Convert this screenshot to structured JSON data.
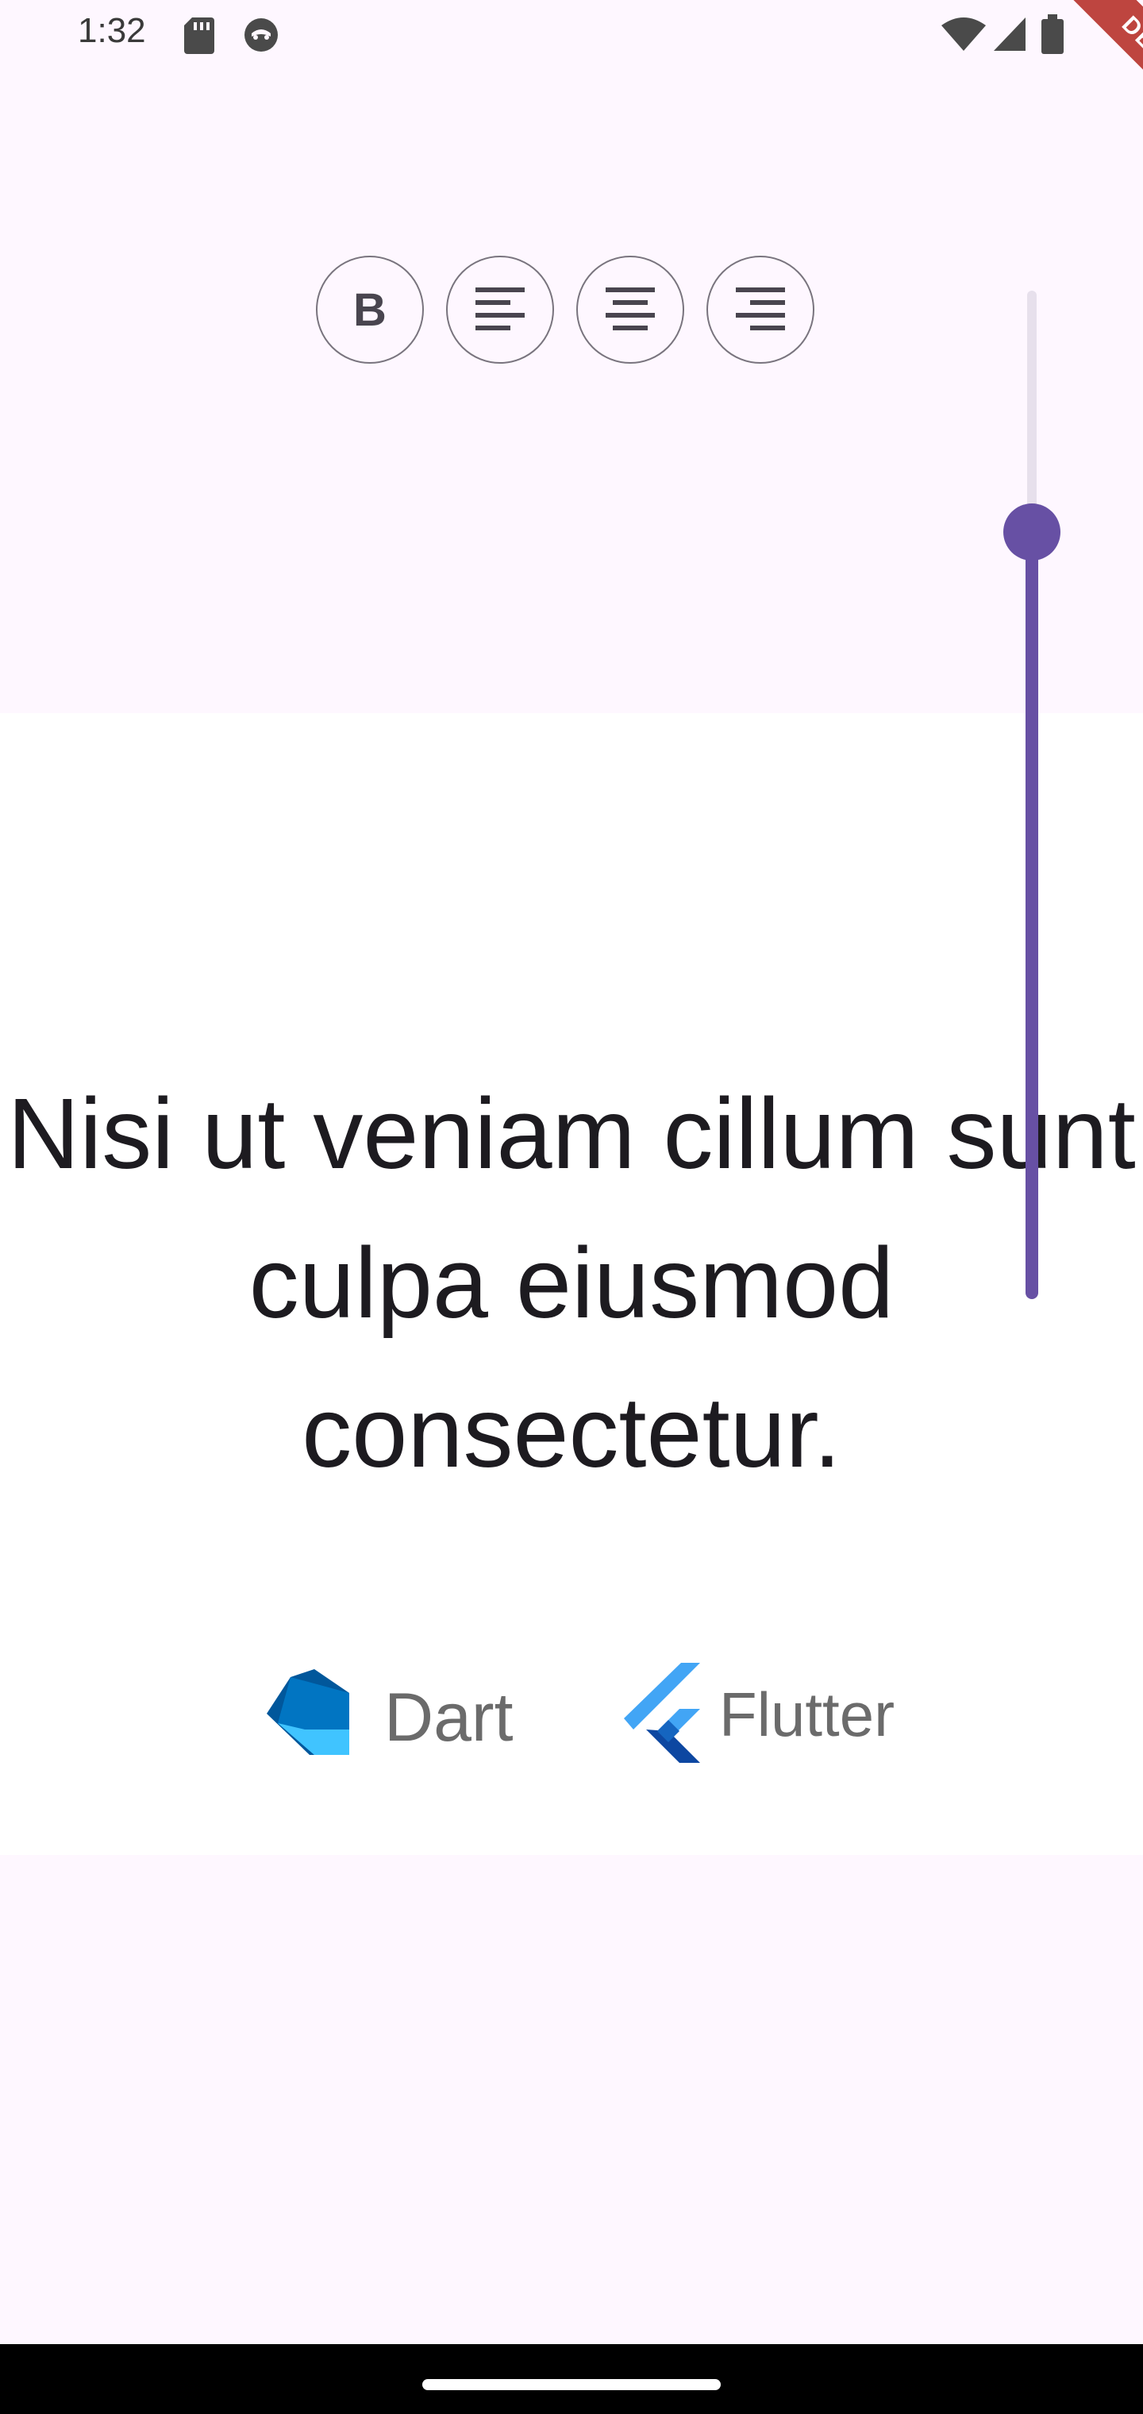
{
  "status_bar": {
    "time": "1:32",
    "icons": [
      "sd-card-icon",
      "cat-face-icon",
      "wifi-icon",
      "cell-signal-icon",
      "battery-icon"
    ]
  },
  "debug_banner": {
    "label": "DEBUG"
  },
  "toolbar": {
    "buttons": [
      {
        "name": "bold",
        "glyph": "B",
        "icon": "bold-icon"
      },
      {
        "name": "align-left",
        "icon": "align-left-icon"
      },
      {
        "name": "align-center",
        "icon": "align-center-icon"
      },
      {
        "name": "align-right",
        "icon": "align-right-icon"
      }
    ]
  },
  "font_size_slider": {
    "orientation": "vertical",
    "value_fraction": 0.75,
    "color": "#6750A4"
  },
  "content": {
    "text": "Nisi ut veniam cillum sunt culpa eiusmod consectetur.",
    "logos": [
      {
        "name": "dart-logo",
        "label": "Dart"
      },
      {
        "name": "flutter-logo",
        "label": "Flutter"
      }
    ]
  },
  "colors": {
    "background": "#FEF7FF",
    "card": "#FFFFFF",
    "primary": "#6750A4",
    "text": "#1D1B20",
    "outline": "#79747E"
  }
}
